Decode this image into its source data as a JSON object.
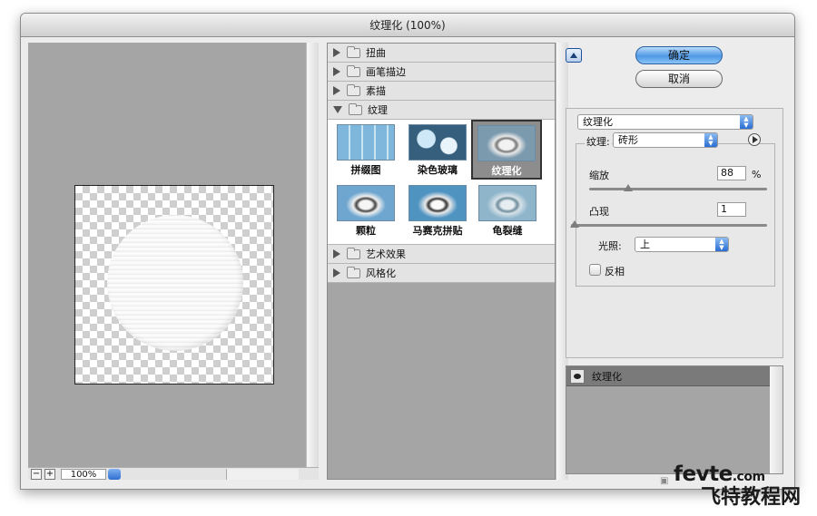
{
  "window": {
    "title": "纹理化 (100%)"
  },
  "preview": {
    "zoom_value": "100%",
    "zoom_out": "−",
    "zoom_in": "+"
  },
  "categories": [
    {
      "label": "扭曲",
      "open": false
    },
    {
      "label": "画笔描边",
      "open": false
    },
    {
      "label": "素描",
      "open": false
    },
    {
      "label": "纹理",
      "open": true
    },
    {
      "label": "艺术效果",
      "open": false
    },
    {
      "label": "风格化",
      "open": false
    }
  ],
  "filters": [
    {
      "label": "拼缀图",
      "selected": false
    },
    {
      "label": "染色玻璃",
      "selected": false
    },
    {
      "label": "纹理化",
      "selected": true
    },
    {
      "label": "颗粒",
      "selected": false
    },
    {
      "label": "马赛克拼贴",
      "selected": false
    },
    {
      "label": "龟裂缝",
      "selected": false
    }
  ],
  "buttons": {
    "ok": "确定",
    "cancel": "取消"
  },
  "params": {
    "filter_select": "纹理化",
    "texture_label": "纹理:",
    "texture_value": "砖形",
    "scaling_label": "缩放",
    "scaling_value": "88",
    "scaling_unit": "%",
    "scaling_fraction": 0.22,
    "relief_label": "凸现",
    "relief_value": "1",
    "relief_fraction": 0.02,
    "light_label": "光照:",
    "light_value": "上",
    "invert_label": "反相"
  },
  "layers": {
    "items": [
      {
        "label": "纹理化"
      }
    ]
  },
  "watermark": {
    "line1": "fevte",
    "line1_suffix": ".com",
    "line2": "飞特教程网"
  }
}
